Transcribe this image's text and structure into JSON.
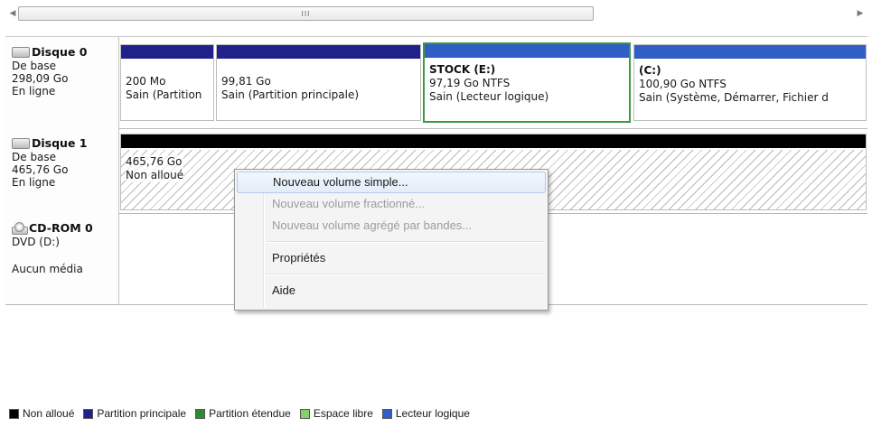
{
  "scrollbar": {
    "grip": "III"
  },
  "disks": [
    {
      "name": "Disque 0",
      "type": "De base",
      "size": "298,09 Go",
      "status": "En ligne",
      "partitions": [
        {
          "label": "",
          "size": "200 Mo",
          "status": "Sain (Partition"
        },
        {
          "label": "",
          "size": "99,81 Go",
          "status": "Sain (Partition principale)"
        },
        {
          "label": "STOCK  (E:)",
          "size": "97,19 Go NTFS",
          "status": "Sain (Lecteur logique)"
        },
        {
          "label": "(C:)",
          "size": "100,90 Go NTFS",
          "status": "Sain (Système, Démarrer, Fichier d"
        }
      ]
    },
    {
      "name": "Disque 1",
      "type": "De base",
      "size": "465,76 Go",
      "status": "En ligne",
      "unallocated": {
        "size": "465,76 Go",
        "status": "Non alloué"
      }
    },
    {
      "name": "CD-ROM 0",
      "type": "DVD (D:)",
      "status": "Aucun média"
    }
  ],
  "context_menu": {
    "items": [
      {
        "label": "Nouveau volume simple..."
      },
      {
        "label": "Nouveau volume fractionné..."
      },
      {
        "label": "Nouveau volume agrégé par bandes..."
      },
      {
        "label": "Propriétés"
      },
      {
        "label": "Aide"
      }
    ]
  },
  "legend": [
    {
      "label": "Non alloué",
      "color": "#000000"
    },
    {
      "label": "Partition principale",
      "color": "#20218a"
    },
    {
      "label": "Partition étendue",
      "color": "#2e8b2e"
    },
    {
      "label": "Espace libre",
      "color": "#7ed36a"
    },
    {
      "label": "Lecteur logique",
      "color": "#2f5fc6"
    }
  ]
}
